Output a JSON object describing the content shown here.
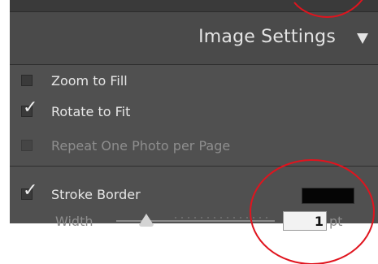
{
  "panel": {
    "header": {
      "title": "Image Settings",
      "collapse_icon": "triangle-down-icon"
    },
    "options": [
      {
        "label": "Zoom to Fill",
        "checked": false,
        "enabled": true
      },
      {
        "label": "Rotate to Fit",
        "checked": true,
        "enabled": true
      },
      {
        "label": "Repeat One Photo per Page",
        "checked": false,
        "enabled": false
      }
    ],
    "stroke_border": {
      "label": "Stroke Border",
      "checked": true,
      "color": "#050505",
      "width_label": "Width",
      "width_value": "1",
      "unit": "pt"
    }
  },
  "annotations": {
    "circle_color": "#e0141e"
  },
  "colors": {
    "panel_background": "#505050",
    "header_background": "#4a4a4a",
    "text": "#e6e6e6",
    "text_disabled": "#8e8e8e"
  }
}
